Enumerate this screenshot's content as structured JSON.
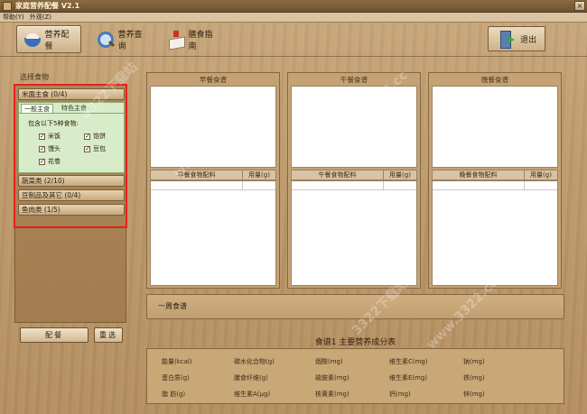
{
  "window": {
    "title": "家庭营养配餐 V2.1",
    "close_glyph": "×"
  },
  "menu": [
    {
      "label": "帮助(Y)"
    },
    {
      "label": "外观(Z)"
    }
  ],
  "toolbar": {
    "buttons": [
      {
        "label": "营养配餐",
        "icon": "bowl-icon",
        "active": true
      },
      {
        "label": "营养查询",
        "icon": "magnifier-icon",
        "active": false
      },
      {
        "label": "膳食指南",
        "icon": "book-icon",
        "active": false
      }
    ],
    "exit_label": "退出"
  },
  "left": {
    "section_label": "选择食物",
    "categories": [
      {
        "label": "米面主食 (0/4)"
      },
      {
        "label": "蔬菜类 (2/10)"
      },
      {
        "label": "豆制品及其它 (0/4)"
      },
      {
        "label": "鱼肉类 (1/5)"
      }
    ],
    "grain": {
      "tabs": [
        {
          "label": "一般主食"
        },
        {
          "label": "特色主食"
        }
      ],
      "include_label": "包含以下5种食物:",
      "items": [
        {
          "label": "米饭",
          "checked": "✓"
        },
        {
          "label": "馅饼",
          "checked": "✓"
        },
        {
          "label": "馒头",
          "checked": "✓"
        },
        {
          "label": "豆包",
          "checked": "✓"
        },
        {
          "label": "花卷",
          "checked": "✓"
        }
      ]
    },
    "buttons": {
      "plan": "配餐",
      "reset": "重选"
    }
  },
  "meals": [
    {
      "title": "早餐食谱",
      "ingredients_header": "早餐食物配料",
      "amount_header": "用量(g)"
    },
    {
      "title": "午餐食谱",
      "ingredients_header": "午餐食物配料",
      "amount_header": "用量(g)"
    },
    {
      "title": "晚餐食谱",
      "ingredients_header": "晚餐食物配料",
      "amount_header": "用量(g)"
    }
  ],
  "weekly": {
    "label": "一周食谱"
  },
  "nutrition": {
    "title": "食谱1 主要营养成分表",
    "rows": [
      [
        "能量(kcal)",
        "碳水化合物(g)",
        "烟酸(mg)",
        "维生素C(mg)",
        "钠(mg)"
      ],
      [
        "蛋白质(g)",
        "膳食纤维(g)",
        "硫胺素(mg)",
        "维生素E(mg)",
        "铁(mg)"
      ],
      [
        "脂  肪(g)",
        "维生素A(μg)",
        "核黄素(mg)",
        "钙(mg)",
        "锌(mg)"
      ]
    ]
  },
  "watermarks": [
    "3322下载站",
    "www.3322.cc"
  ]
}
